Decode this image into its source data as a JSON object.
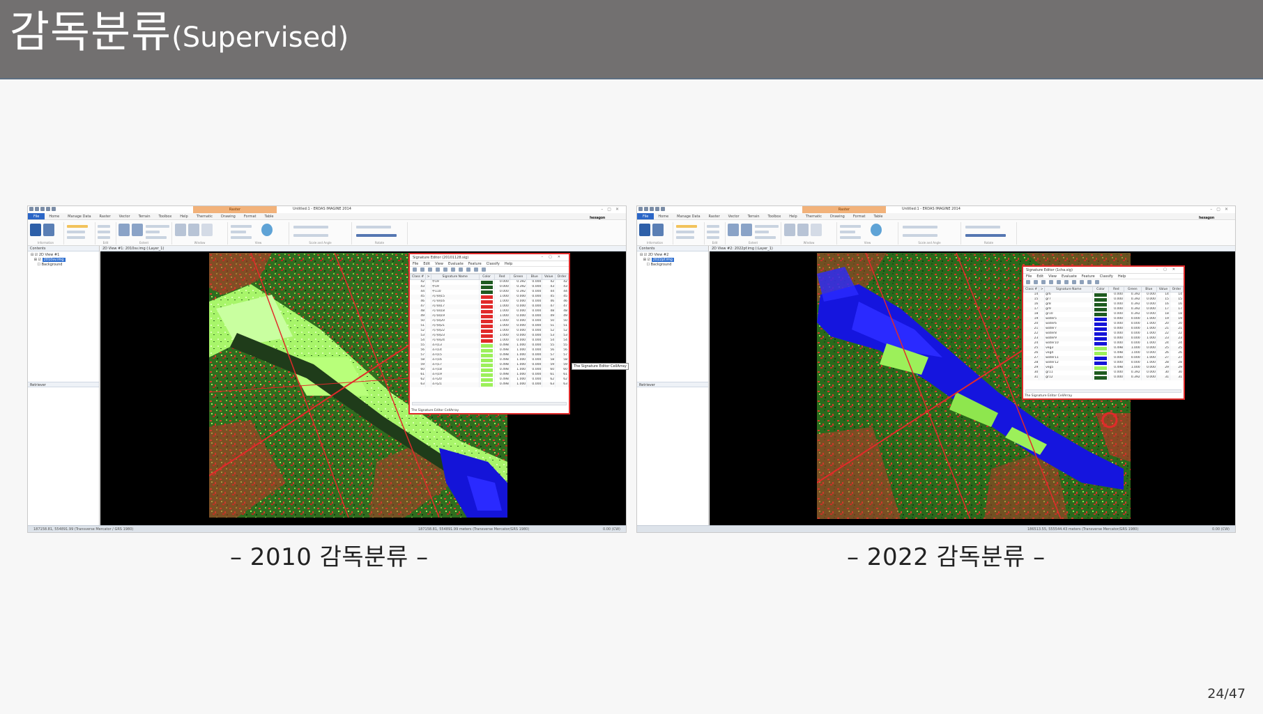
{
  "slide": {
    "title": "감독분류",
    "title_sub": "(Supervised)",
    "page": "24/47"
  },
  "panels": [
    {
      "caption": "– 2010 감독분류 –",
      "app_title": "Untitled:1 - ERDAS IMAGINE 2014",
      "context_tab": "Raster",
      "menu": [
        "File",
        "Home",
        "Manage Data",
        "Raster",
        "Vector",
        "Terrain",
        "Toolbox",
        "Help",
        "Thematic",
        "Drawing",
        "Format",
        "Table"
      ],
      "brand": "hexagon",
      "ribbon_groups": [
        "Information",
        "Edit",
        "Extent",
        "Window",
        "View",
        "Scale and Angle",
        "Rotate"
      ],
      "ribbon_labels": {
        "contents": "Contents",
        "metadata": "Metadata",
        "select": "Select",
        "inquire": "Inquire",
        "measure": "Measure",
        "cut": "Cut",
        "copy": "Copy",
        "paste": "Paste",
        "fit": "Fit to Frame",
        "reset": "Reset",
        "previous_extent": "Previous Extent",
        "pan": "Pan",
        "scale": "1:24213",
        "align_north": "Align North",
        "add_views": "Add Views",
        "link_views": "Link Views",
        "equalize": "Equalize Scales",
        "clear_view": "Clear View",
        "basemap": "Basemap"
      },
      "contents_label": "Contents",
      "tree": [
        "2D View #1",
        "2010sv.img",
        "Background"
      ],
      "retriever_label": "Retriever",
      "view_header": "2D View #1: 2010sv.img (:Layer_1)",
      "status_left": "187158.81, 554891.99  (Transverse Mercator / GRS 1980)",
      "status_mid": "187158.81, 554891.99 meters (Transverse Mercator/GRS 1980)",
      "status_right": "0.00 (CW)",
      "tooltip": "The Signature Editor CellArray",
      "sig_editor": {
        "title": "Signature Editor (20101128.sig)",
        "menu": [
          "File",
          "Edit",
          "View",
          "Evaluate",
          "Feature",
          "Classify",
          "Help"
        ],
        "headers": [
          "Class #",
          ">",
          "Signature Name",
          "Color",
          "Red",
          "Green",
          "Blue",
          "Value",
          "Order"
        ],
        "rows": [
          {
            "cls": "42",
            "name": "수19",
            "color": "#1e5b20",
            "r": "0.000",
            "g": "0.392",
            "b": "0.000",
            "v": "42",
            "o": "42"
          },
          {
            "cls": "43",
            "name": "수19",
            "color": "#1e5b20",
            "r": "0.000",
            "g": "0.392",
            "b": "0.000",
            "v": "43",
            "o": "43"
          },
          {
            "cls": "44",
            "name": "수110",
            "color": "#1e5b20",
            "r": "0.000",
            "g": "0.392",
            "b": "0.000",
            "v": "44",
            "o": "44"
          },
          {
            "cls": "45",
            "name": "시가화15",
            "color": "#e12a2a",
            "r": "1.000",
            "g": "0.000",
            "b": "0.000",
            "v": "45",
            "o": "45"
          },
          {
            "cls": "46",
            "name": "시가화16",
            "color": "#e12a2a",
            "r": "1.000",
            "g": "0.000",
            "b": "0.000",
            "v": "46",
            "o": "46"
          },
          {
            "cls": "47",
            "name": "시가화17",
            "color": "#e12a2a",
            "r": "1.000",
            "g": "0.000",
            "b": "0.000",
            "v": "47",
            "o": "47"
          },
          {
            "cls": "48",
            "name": "시가화18",
            "color": "#e12a2a",
            "r": "1.000",
            "g": "0.000",
            "b": "0.000",
            "v": "48",
            "o": "48"
          },
          {
            "cls": "49",
            "name": "시가화19",
            "color": "#e12a2a",
            "r": "1.000",
            "g": "0.000",
            "b": "0.000",
            "v": "49",
            "o": "49"
          },
          {
            "cls": "50",
            "name": "시가화20",
            "color": "#e12a2a",
            "r": "1.000",
            "g": "0.000",
            "b": "0.000",
            "v": "50",
            "o": "50"
          },
          {
            "cls": "51",
            "name": "시가화21",
            "color": "#e12a2a",
            "r": "1.000",
            "g": "0.000",
            "b": "0.000",
            "v": "51",
            "o": "51"
          },
          {
            "cls": "52",
            "name": "시가화22",
            "color": "#e12a2a",
            "r": "1.000",
            "g": "0.000",
            "b": "0.000",
            "v": "52",
            "o": "52"
          },
          {
            "cls": "53",
            "name": "시가화23",
            "color": "#e12a2a",
            "r": "1.000",
            "g": "0.000",
            "b": "0.000",
            "v": "53",
            "o": "53"
          },
          {
            "cls": "54",
            "name": "시가화24",
            "color": "#e12a2a",
            "r": "1.000",
            "g": "0.000",
            "b": "0.000",
            "v": "54",
            "o": "54"
          },
          {
            "cls": "55",
            "name": "초지13",
            "color": "#9cf05a",
            "r": "0.498",
            "g": "1.000",
            "b": "0.000",
            "v": "55",
            "o": "55"
          },
          {
            "cls": "56",
            "name": "초지14",
            "color": "#9cf05a",
            "r": "0.498",
            "g": "1.000",
            "b": "0.000",
            "v": "56",
            "o": "56"
          },
          {
            "cls": "57",
            "name": "초지15",
            "color": "#9cf05a",
            "r": "0.498",
            "g": "1.000",
            "b": "0.000",
            "v": "57",
            "o": "57"
          },
          {
            "cls": "58",
            "name": "초지16",
            "color": "#9cf05a",
            "r": "0.498",
            "g": "1.000",
            "b": "0.000",
            "v": "58",
            "o": "58"
          },
          {
            "cls": "59",
            "name": "초지17",
            "color": "#9cf05a",
            "r": "0.498",
            "g": "1.000",
            "b": "0.000",
            "v": "59",
            "o": "59"
          },
          {
            "cls": "60",
            "name": "초지18",
            "color": "#9cf05a",
            "r": "0.498",
            "g": "1.000",
            "b": "0.000",
            "v": "60",
            "o": "60"
          },
          {
            "cls": "61",
            "name": "초지19",
            "color": "#9cf05a",
            "r": "0.498",
            "g": "1.000",
            "b": "0.000",
            "v": "61",
            "o": "61"
          },
          {
            "cls": "62",
            "name": "초지20",
            "color": "#9cf05a",
            "r": "0.498",
            "g": "1.000",
            "b": "0.000",
            "v": "62",
            "o": "62"
          },
          {
            "cls": "63",
            "name": "초지21",
            "color": "#9cf05a",
            "r": "0.498",
            "g": "1.000",
            "b": "0.000",
            "v": "63",
            "o": "63"
          }
        ],
        "footer": "The Signature Editor CellArray"
      }
    },
    {
      "caption": "– 2022 감독분류 –",
      "app_title": "Untitled:1 - ERDAS IMAGINE 2014",
      "context_tab": "Raster",
      "menu": [
        "File",
        "Home",
        "Manage Data",
        "Raster",
        "Vector",
        "Terrain",
        "Toolbox",
        "Help",
        "Thematic",
        "Drawing",
        "Format",
        "Table"
      ],
      "brand": "hexagon",
      "ribbon_groups": [
        "Information",
        "Edit",
        "Extent",
        "Window",
        "View",
        "Scale and Angle",
        "Rotate"
      ],
      "ribbon_labels": {
        "contents": "Contents",
        "metadata": "Metadata",
        "select": "Select",
        "inquire": "Inquire",
        "measure": "Measure",
        "cut": "Cut",
        "copy": "Copy",
        "paste": "Paste",
        "fit": "Fit to Frame",
        "reset": "Reset",
        "previous_extent": "Previous Extent",
        "pan": "Pan",
        "scale": "1:23996",
        "align_north": "Align North",
        "add_views": "Add Views",
        "link_views": "Link Views",
        "equalize": "Equalize Scales",
        "clear_view": "Clear View",
        "basemap": "Basemap"
      },
      "contents_label": "Contents",
      "tree": [
        "2D View #2",
        "2022pf.img",
        "Background"
      ],
      "retriever_label": "Retriever",
      "view_header": "2D View #2: 2022pf.img (:Layer_1)",
      "status_left": "",
      "status_mid": "186513.55, 555544.43 meters (Transverse Mercator/GRS 1980)",
      "status_right": "0.00 (CW)",
      "sig_editor": {
        "title": "Signature Editor (1cha.sig)",
        "menu": [
          "File",
          "Edit",
          "View",
          "Evaluate",
          "Feature",
          "Classify",
          "Help"
        ],
        "headers": [
          "Class #",
          ">",
          "Signature Name",
          "Color",
          "Red",
          "Green",
          "Blue",
          "Value",
          "Order"
        ],
        "rows": [
          {
            "cls": "14",
            "name": "gr6",
            "color": "#1e5b20",
            "r": "0.000",
            "g": "0.392",
            "b": "0.000",
            "v": "14",
            "o": "14"
          },
          {
            "cls": "15",
            "name": "gr7",
            "color": "#1e5b20",
            "r": "0.000",
            "g": "0.392",
            "b": "0.000",
            "v": "15",
            "o": "15"
          },
          {
            "cls": "16",
            "name": "gr8",
            "color": "#1e5b20",
            "r": "0.000",
            "g": "0.392",
            "b": "0.000",
            "v": "16",
            "o": "16"
          },
          {
            "cls": "17",
            "name": "gr9",
            "color": "#1e5b20",
            "r": "0.000",
            "g": "0.392",
            "b": "0.000",
            "v": "17",
            "o": "17"
          },
          {
            "cls": "18",
            "name": "gr10",
            "color": "#1e5b20",
            "r": "0.000",
            "g": "0.392",
            "b": "0.000",
            "v": "18",
            "o": "18"
          },
          {
            "cls": "19",
            "name": "water5",
            "color": "#1414d8",
            "r": "0.000",
            "g": "0.000",
            "b": "1.000",
            "v": "19",
            "o": "19"
          },
          {
            "cls": "20",
            "name": "water6",
            "color": "#1414d8",
            "r": "0.000",
            "g": "0.000",
            "b": "1.000",
            "v": "20",
            "o": "20"
          },
          {
            "cls": "21",
            "name": "water7",
            "color": "#1414d8",
            "r": "0.000",
            "g": "0.000",
            "b": "1.000",
            "v": "21",
            "o": "21"
          },
          {
            "cls": "22",
            "name": "water8",
            "color": "#1414d8",
            "r": "0.000",
            "g": "0.000",
            "b": "1.000",
            "v": "22",
            "o": "22"
          },
          {
            "cls": "23",
            "name": "water9",
            "color": "#1414d8",
            "r": "0.000",
            "g": "0.000",
            "b": "1.000",
            "v": "23",
            "o": "23"
          },
          {
            "cls": "24",
            "name": "water10",
            "color": "#1414d8",
            "r": "0.000",
            "g": "0.000",
            "b": "1.000",
            "v": "24",
            "o": "24"
          },
          {
            "cls": "25",
            "name": "veg3",
            "color": "#9cf05a",
            "r": "0.498",
            "g": "1.000",
            "b": "0.000",
            "v": "25",
            "o": "25"
          },
          {
            "cls": "26",
            "name": "veg4",
            "color": "#9cf05a",
            "r": "0.498",
            "g": "1.000",
            "b": "0.000",
            "v": "26",
            "o": "26"
          },
          {
            "cls": "27",
            "name": "water11",
            "color": "#1414d8",
            "r": "0.000",
            "g": "0.000",
            "b": "1.000",
            "v": "27",
            "o": "27"
          },
          {
            "cls": "28",
            "name": "water12",
            "color": "#1414d8",
            "r": "0.000",
            "g": "0.000",
            "b": "1.000",
            "v": "28",
            "o": "28"
          },
          {
            "cls": "29",
            "name": "veg5",
            "color": "#9cf05a",
            "r": "0.498",
            "g": "1.000",
            "b": "0.000",
            "v": "29",
            "o": "29"
          },
          {
            "cls": "30",
            "name": "gr11",
            "color": "#1e5b20",
            "r": "0.000",
            "g": "0.392",
            "b": "0.000",
            "v": "30",
            "o": "30"
          },
          {
            "cls": "31",
            "name": "gr12",
            "color": "#1e5b20",
            "r": "0.000",
            "g": "0.392",
            "b": "0.000",
            "v": "31",
            "o": "31"
          }
        ],
        "footer": "The Signature Editor CellArray"
      }
    }
  ],
  "colors": {
    "title_bar": "#727070",
    "class_forest": "#1e5b20",
    "class_urban": "#e12a2a",
    "class_grass": "#9cf05a",
    "class_water": "#1414d8",
    "highlight_border": "#e02a2a"
  }
}
